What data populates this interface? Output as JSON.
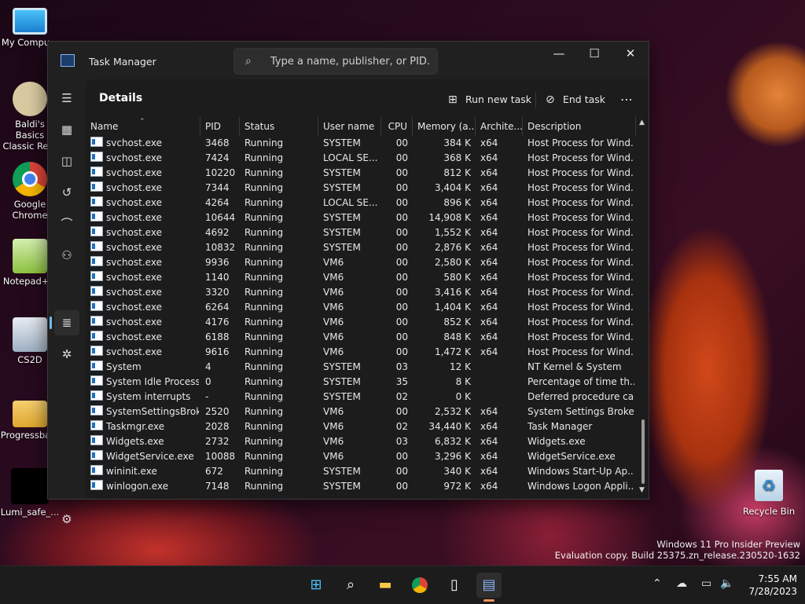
{
  "desktop": {
    "icons": [
      {
        "label": "My Compu...",
        "color": "#2aa0e6"
      },
      {
        "label": "Baldi's Basics Classic Re...",
        "color": "#cfc49a"
      },
      {
        "label": "Google Chrome",
        "color": "#3b87e0"
      },
      {
        "label": "Notepad++",
        "color": "#8dc13f"
      },
      {
        "label": "CS2D",
        "color": "#cfd6e0"
      },
      {
        "label": "Progressba...",
        "color": "#e7b23b"
      },
      {
        "label": "Lumi_safe_...",
        "color": "#000000"
      }
    ],
    "recycle_bin": "Recycle Bin",
    "watermark_line1": "Windows 11 Pro Insider Preview",
    "watermark_line2": "Evaluation copy. Build 25375.zn_release.230520-1632"
  },
  "window": {
    "title": "Task Manager",
    "search_placeholder": "Type a name, publisher, or PID...",
    "minimize": "—",
    "maximize": "☐",
    "close": "✕",
    "page_title": "Details",
    "run_new_task": "Run new task",
    "end_task": "End task",
    "more": "⋯"
  },
  "columns": [
    "Name",
    "PID",
    "Status",
    "User name",
    "CPU",
    "Memory (a...",
    "Archite...",
    "Description"
  ],
  "processes": [
    {
      "name": "svchost.exe",
      "pid": "3468",
      "status": "Running",
      "user": "SYSTEM",
      "cpu": "00",
      "mem": "384 K",
      "arch": "x64",
      "desc": "Host Process for Wind..."
    },
    {
      "name": "svchost.exe",
      "pid": "7424",
      "status": "Running",
      "user": "LOCAL SE...",
      "cpu": "00",
      "mem": "368 K",
      "arch": "x64",
      "desc": "Host Process for Wind..."
    },
    {
      "name": "svchost.exe",
      "pid": "10220",
      "status": "Running",
      "user": "SYSTEM",
      "cpu": "00",
      "mem": "812 K",
      "arch": "x64",
      "desc": "Host Process for Wind..."
    },
    {
      "name": "svchost.exe",
      "pid": "7344",
      "status": "Running",
      "user": "SYSTEM",
      "cpu": "00",
      "mem": "3,404 K",
      "arch": "x64",
      "desc": "Host Process for Wind..."
    },
    {
      "name": "svchost.exe",
      "pid": "4264",
      "status": "Running",
      "user": "LOCAL SE...",
      "cpu": "00",
      "mem": "896 K",
      "arch": "x64",
      "desc": "Host Process for Wind..."
    },
    {
      "name": "svchost.exe",
      "pid": "10644",
      "status": "Running",
      "user": "SYSTEM",
      "cpu": "00",
      "mem": "14,908 K",
      "arch": "x64",
      "desc": "Host Process for Wind..."
    },
    {
      "name": "svchost.exe",
      "pid": "4692",
      "status": "Running",
      "user": "SYSTEM",
      "cpu": "00",
      "mem": "1,552 K",
      "arch": "x64",
      "desc": "Host Process for Wind..."
    },
    {
      "name": "svchost.exe",
      "pid": "10832",
      "status": "Running",
      "user": "SYSTEM",
      "cpu": "00",
      "mem": "2,876 K",
      "arch": "x64",
      "desc": "Host Process for Wind..."
    },
    {
      "name": "svchost.exe",
      "pid": "9936",
      "status": "Running",
      "user": "VM6",
      "cpu": "00",
      "mem": "2,580 K",
      "arch": "x64",
      "desc": "Host Process for Wind..."
    },
    {
      "name": "svchost.exe",
      "pid": "1140",
      "status": "Running",
      "user": "VM6",
      "cpu": "00",
      "mem": "580 K",
      "arch": "x64",
      "desc": "Host Process for Wind..."
    },
    {
      "name": "svchost.exe",
      "pid": "3320",
      "status": "Running",
      "user": "VM6",
      "cpu": "00",
      "mem": "3,416 K",
      "arch": "x64",
      "desc": "Host Process for Wind..."
    },
    {
      "name": "svchost.exe",
      "pid": "6264",
      "status": "Running",
      "user": "VM6",
      "cpu": "00",
      "mem": "1,404 K",
      "arch": "x64",
      "desc": "Host Process for Wind..."
    },
    {
      "name": "svchost.exe",
      "pid": "4176",
      "status": "Running",
      "user": "VM6",
      "cpu": "00",
      "mem": "852 K",
      "arch": "x64",
      "desc": "Host Process for Wind..."
    },
    {
      "name": "svchost.exe",
      "pid": "6188",
      "status": "Running",
      "user": "VM6",
      "cpu": "00",
      "mem": "848 K",
      "arch": "x64",
      "desc": "Host Process for Wind..."
    },
    {
      "name": "svchost.exe",
      "pid": "9616",
      "status": "Running",
      "user": "VM6",
      "cpu": "00",
      "mem": "1,472 K",
      "arch": "x64",
      "desc": "Host Process for Wind..."
    },
    {
      "name": "System",
      "pid": "4",
      "status": "Running",
      "user": "SYSTEM",
      "cpu": "03",
      "mem": "12 K",
      "arch": "",
      "desc": "NT Kernel & System"
    },
    {
      "name": "System Idle Process",
      "pid": "0",
      "status": "Running",
      "user": "SYSTEM",
      "cpu": "35",
      "mem": "8 K",
      "arch": "",
      "desc": "Percentage of time th..."
    },
    {
      "name": "System interrupts",
      "pid": "-",
      "status": "Running",
      "user": "SYSTEM",
      "cpu": "02",
      "mem": "0 K",
      "arch": "",
      "desc": "Deferred procedure ca..."
    },
    {
      "name": "SystemSettingsBroke...",
      "pid": "2520",
      "status": "Running",
      "user": "VM6",
      "cpu": "00",
      "mem": "2,532 K",
      "arch": "x64",
      "desc": "System Settings Broker"
    },
    {
      "name": "Taskmgr.exe",
      "pid": "2028",
      "status": "Running",
      "user": "VM6",
      "cpu": "02",
      "mem": "34,440 K",
      "arch": "x64",
      "desc": "Task Manager"
    },
    {
      "name": "Widgets.exe",
      "pid": "2732",
      "status": "Running",
      "user": "VM6",
      "cpu": "03",
      "mem": "6,832 K",
      "arch": "x64",
      "desc": "Widgets.exe"
    },
    {
      "name": "WidgetService.exe",
      "pid": "10088",
      "status": "Running",
      "user": "VM6",
      "cpu": "00",
      "mem": "3,296 K",
      "arch": "x64",
      "desc": "WidgetService.exe"
    },
    {
      "name": "wininit.exe",
      "pid": "672",
      "status": "Running",
      "user": "SYSTEM",
      "cpu": "00",
      "mem": "340 K",
      "arch": "x64",
      "desc": "Windows Start-Up Ap..."
    },
    {
      "name": "winlogon.exe",
      "pid": "7148",
      "status": "Running",
      "user": "SYSTEM",
      "cpu": "00",
      "mem": "972 K",
      "arch": "x64",
      "desc": "Windows Logon Appli..."
    }
  ],
  "taskbar": {
    "time": "7:55 AM",
    "date": "7/28/2023"
  },
  "colors": {
    "accent": "#76b9ed",
    "taskbar_indicator": "#f0925b"
  }
}
